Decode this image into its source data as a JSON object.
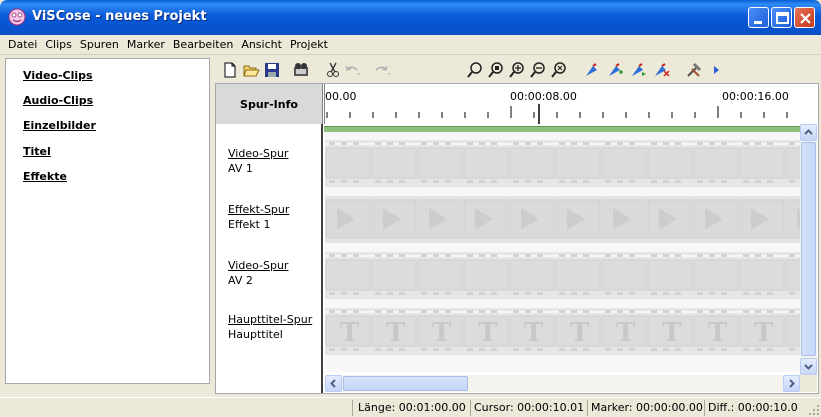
{
  "window": {
    "title": "ViSCose - neues Projekt",
    "controls": [
      "minimize-icon",
      "maximize-icon",
      "close-icon"
    ]
  },
  "menu": {
    "items": [
      "Datei",
      "Clips",
      "Spuren",
      "Marker",
      "Bearbeiten",
      "Ansicht",
      "Projekt"
    ]
  },
  "sidebar": {
    "items": [
      {
        "label": "Video-Clips"
      },
      {
        "label": "Audio-Clips"
      },
      {
        "label": "Einzelbilder"
      },
      {
        "label": "Titel"
      },
      {
        "label": "Effekte"
      }
    ]
  },
  "toolbar": {
    "icons": [
      "new-file-icon",
      "open-folder-icon",
      "save-icon",
      "render-video-icon",
      "cut-icon",
      "undo-icon",
      "redo-icon",
      "zoom-icon",
      "zoom-fit-icon",
      "zoom-in-icon",
      "zoom-out-icon",
      "zoom-all-icon",
      "marker-icon",
      "marker-add-icon",
      "marker-next-icon",
      "marker-delete-icon",
      "tools-icon",
      "play-icon"
    ]
  },
  "timeline": {
    "header": "Spur-Info",
    "ruler_labels": [
      "00.00",
      "00:00:08.00",
      "00:00:16.00"
    ],
    "tracks": [
      {
        "name": "Video-Spur",
        "sub": "AV 1",
        "kind": "video"
      },
      {
        "name": "Effekt-Spur",
        "sub": "Effekt 1",
        "kind": "effect"
      },
      {
        "name": "Video-Spur",
        "sub": "AV 2",
        "kind": "video"
      },
      {
        "name": "Haupttitel-Spur",
        "sub": "Haupttitel",
        "kind": "title"
      }
    ],
    "title_glyph": "T"
  },
  "status": {
    "laenge": "Länge: 00:01:00.00",
    "cursor": "Cursor: 00:00:10.01",
    "marker": "Marker: 00:00:00.00",
    "diff": "Diff.: 00:00:10.0"
  },
  "colors": {
    "titlebar": "#0a5fd6",
    "timeline_green": "#8bbf7a",
    "chrome": "#ece9d8"
  }
}
